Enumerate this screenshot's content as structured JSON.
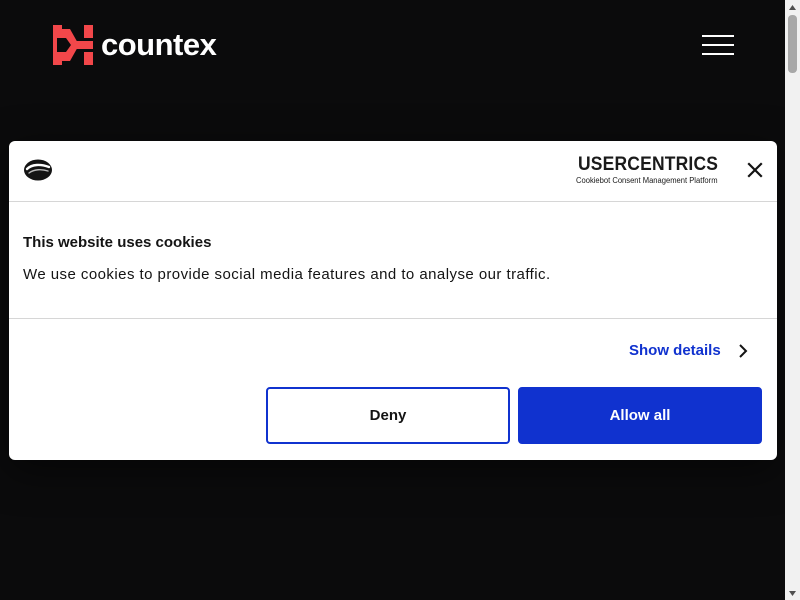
{
  "site": {
    "brand": "countex",
    "colors": {
      "background": "#0b0b0c",
      "brand_accent": "#f2474a"
    }
  },
  "cookie_dialog": {
    "provider_name": "USERCENTRICS",
    "provider_subtitle": "Cookiebot Consent Management Platform",
    "title": "This website uses cookies",
    "message": "We use cookies to provide social media features and to analyse our traffic.",
    "show_details_label": "Show details",
    "deny_label": "Deny",
    "allow_all_label": "Allow all",
    "colors": {
      "primary": "#1032cf",
      "text": "#141414",
      "divider": "#d6d6d6"
    }
  },
  "icons": {
    "logo": "countex-logo-mark",
    "menu": "hamburger-menu-icon",
    "cookie": "cookie-icon",
    "close": "close-icon",
    "chevron": "chevron-right-icon"
  }
}
